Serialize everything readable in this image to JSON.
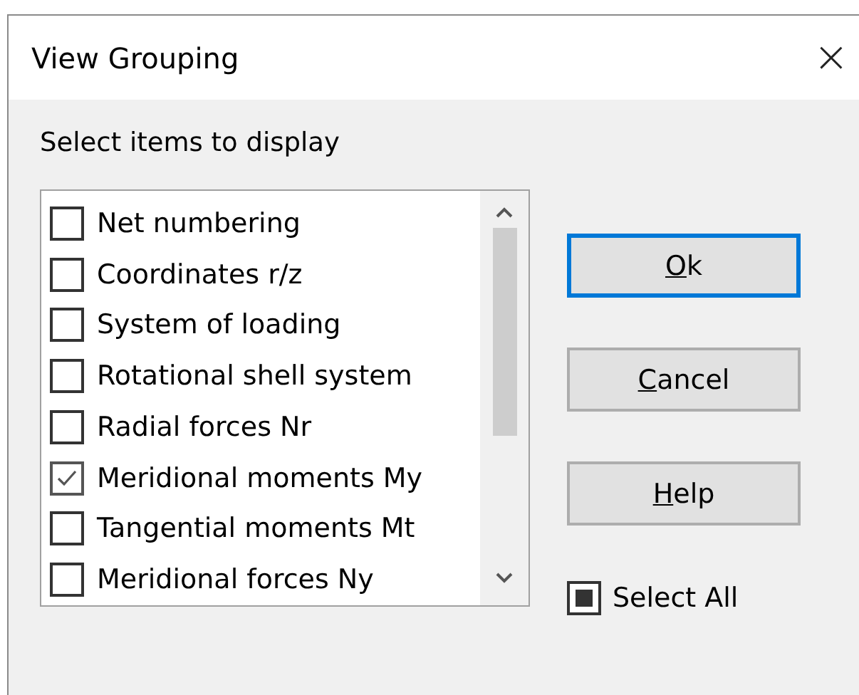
{
  "window": {
    "title": "View Grouping",
    "close": "×"
  },
  "prompt": "Select items to display",
  "items": [
    {
      "label": "Net numbering",
      "checked": false
    },
    {
      "label": "Coordinates r/z",
      "checked": false
    },
    {
      "label": "System of loading",
      "checked": false
    },
    {
      "label": "Rotational shell system",
      "checked": false
    },
    {
      "label": "Radial forces Nr",
      "checked": false
    },
    {
      "label": "Meridional moments My",
      "checked": true
    },
    {
      "label": "Tangential moments Mt",
      "checked": false
    },
    {
      "label": "Meridional forces Ny",
      "checked": false
    }
  ],
  "buttons": [
    {
      "mnemonic": "O",
      "rest": "k",
      "default": true
    },
    {
      "mnemonic": "C",
      "rest": "ancel",
      "default": false
    },
    {
      "mnemonic": "H",
      "rest": "elp",
      "default": false
    }
  ],
  "select_all": {
    "label": "Select All",
    "mixed": true
  }
}
